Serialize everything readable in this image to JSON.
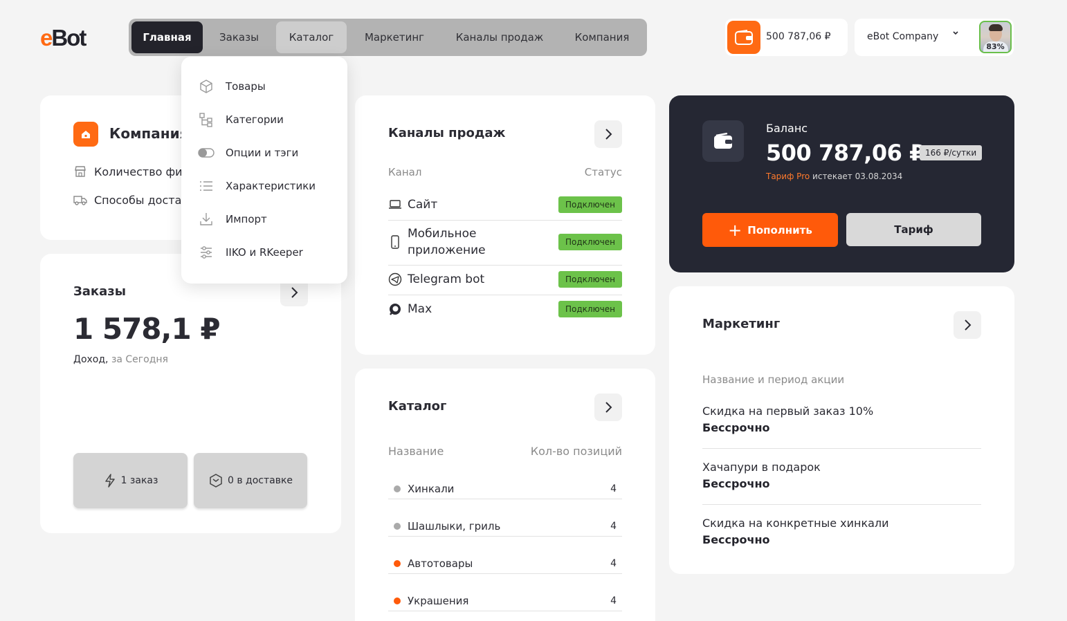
{
  "logo": {
    "e": "e",
    "rest": "Bot"
  },
  "nav": {
    "tabs": [
      {
        "label": "Главная"
      },
      {
        "label": "Заказы"
      },
      {
        "label": "Каталог"
      },
      {
        "label": "Маркетинг"
      },
      {
        "label": "Каналы продаж"
      },
      {
        "label": "Компания"
      }
    ]
  },
  "header": {
    "wallet_amount": "500 787,06 ₽",
    "company_name": "eBot Company",
    "avatar_percent": "83%"
  },
  "catalog_menu": {
    "items": [
      {
        "label": "Товары",
        "icon": "box-icon"
      },
      {
        "label": "Категории",
        "icon": "tree-icon"
      },
      {
        "label": "Опции и тэги",
        "icon": "toggle-icon"
      },
      {
        "label": "Характеристики",
        "icon": "list-icon"
      },
      {
        "label": "Импорт",
        "icon": "download-icon"
      },
      {
        "label": "IIKO и RKeeper",
        "icon": "sliders-icon"
      }
    ]
  },
  "company_card": {
    "title": "Компания",
    "rows": [
      {
        "label": "Количество фи",
        "icon": "store-icon"
      },
      {
        "label": "Способы доста",
        "icon": "truck-icon"
      }
    ]
  },
  "orders_card": {
    "title": "Заказы",
    "amount": "1 578,1 ₽",
    "income_label": "Доход,",
    "period": "за Сегодня",
    "stats": [
      {
        "label": "1 заказ",
        "icon": "bolt-icon"
      },
      {
        "label": "0 в доставке",
        "icon": "package-icon"
      }
    ]
  },
  "channels_card": {
    "title": "Каналы продаж",
    "col_channel": "Канал",
    "col_status": "Статус",
    "rows": [
      {
        "name": "Сайт",
        "status": "Подключен",
        "icon": "laptop-icon"
      },
      {
        "name": "Мобильное приложение",
        "status": "Подключен",
        "icon": "phone-icon"
      },
      {
        "name": "Telegram bot",
        "status": "Подключен",
        "icon": "telegram-icon"
      },
      {
        "name": "Max",
        "status": "Подключен",
        "icon": "max-icon"
      }
    ]
  },
  "catalog_card": {
    "title": "Каталог",
    "col_name": "Название",
    "col_count": "Кол-во позиций",
    "rows": [
      {
        "name": "Хинкали",
        "count": "4",
        "dot_color": "#aaaaaa"
      },
      {
        "name": "Шашлыки, гриль",
        "count": "4",
        "dot_color": "#aaaaaa"
      },
      {
        "name": "Автотовары",
        "count": "4",
        "dot_color": "#ff5a0a"
      },
      {
        "name": "Украшения",
        "count": "4",
        "dot_color": "#ff5a0a"
      }
    ]
  },
  "balance_card": {
    "label": "Баланс",
    "amount": "500 787,06 ₽",
    "rate": "166 ₽/сутки",
    "tariff_name": "Тариф Pro",
    "tariff_expires": "истекает 03.08.2034",
    "topup_label": "Пополнить",
    "tariff_button": "Тариф"
  },
  "marketing_card": {
    "title": "Маркетинг",
    "col_header": "Название и период акции",
    "items": [
      {
        "name": "Скидка на первый заказ 10%",
        "period": "Бессрочно"
      },
      {
        "name": "Хачапури в подарок",
        "period": "Бессрочно"
      },
      {
        "name": "Скидка на конкретные хинкали",
        "period": "Бессрочно"
      }
    ]
  },
  "colors": {
    "accent": "#ff6a13",
    "dark": "#23232b",
    "status_green": "#6cc24a",
    "background": "#f4f4f4"
  }
}
